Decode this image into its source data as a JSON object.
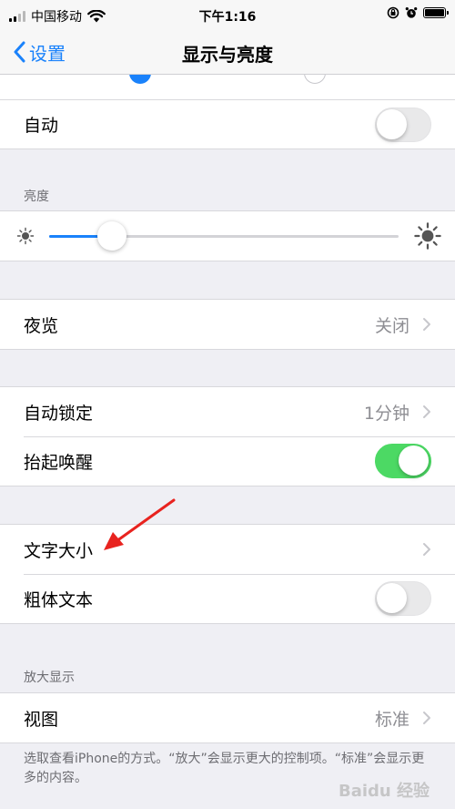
{
  "status_bar": {
    "carrier": "中国移动",
    "time": "下午1:16",
    "signal_bars_filled": 2,
    "signal_bars_total": 4
  },
  "nav": {
    "back_label": "设置",
    "title": "显示与亮度"
  },
  "appearance_group": {
    "automatic_label": "自动",
    "automatic_on": false
  },
  "brightness": {
    "header": "亮度",
    "level": 0.18
  },
  "night_shift": {
    "label": "夜览",
    "value": "关闭"
  },
  "lock_group": {
    "auto_lock_label": "自动锁定",
    "auto_lock_value": "1分钟",
    "raise_to_wake_label": "抬起唤醒",
    "raise_to_wake_on": true
  },
  "text_group": {
    "text_size_label": "文字大小",
    "bold_text_label": "粗体文本",
    "bold_text_on": false
  },
  "zoom": {
    "header": "放大显示",
    "view_label": "视图",
    "view_value": "标准",
    "footer": "选取查看iPhone的方式。“放大”会显示更大的控制项。“标准”会显示更多的内容。"
  },
  "watermark": "Baidu 经验",
  "colors": {
    "accent": "#1a82fb",
    "toggle_on": "#4cd964",
    "annotation_arrow": "#e8231f"
  }
}
